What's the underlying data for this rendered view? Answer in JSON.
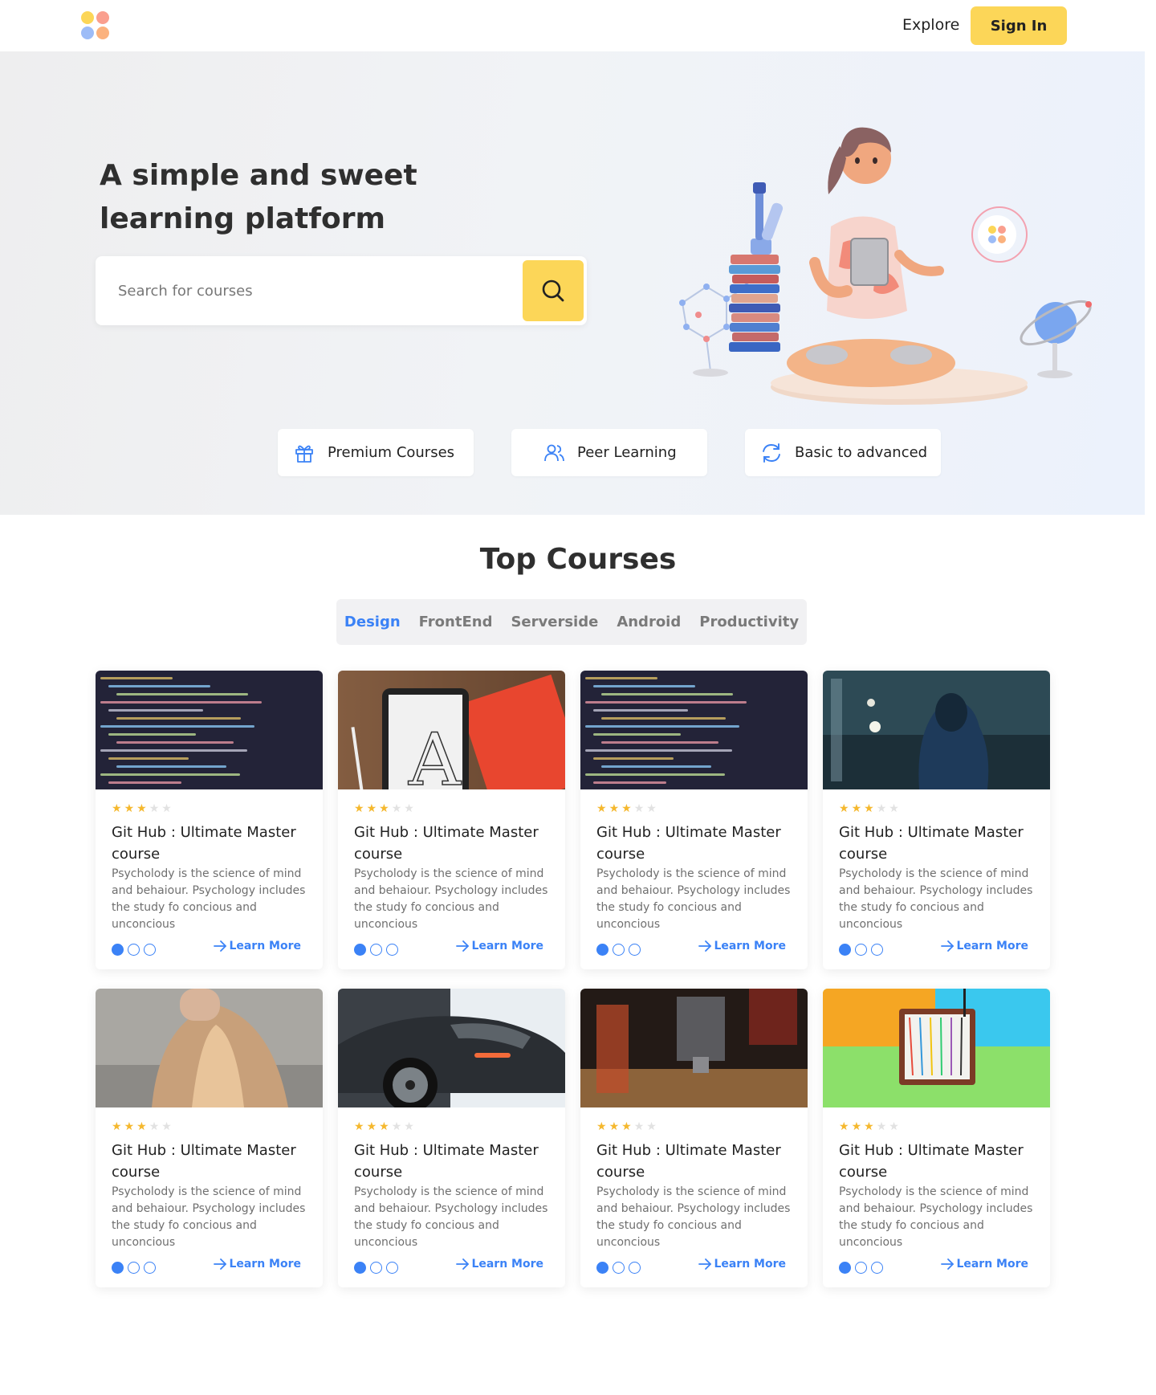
{
  "header": {
    "nav_explore": "Explore",
    "signin_label": "Sign In",
    "logo_colors": [
      "#fcd658",
      "#fa9f8e",
      "#9dbcf7",
      "#fbb27e"
    ]
  },
  "hero": {
    "title": "A simple and sweet learning platform",
    "search": {
      "placeholder": "Search for courses",
      "value": ""
    },
    "features": [
      {
        "label": "Premium Courses",
        "icon": "gift-icon"
      },
      {
        "label": "Peer Learning",
        "icon": "users-icon"
      },
      {
        "label": "Basic to advanced",
        "icon": "refresh-icon"
      }
    ]
  },
  "top_courses": {
    "title": "Top Courses",
    "tabs": [
      {
        "label": "Design",
        "active": true
      },
      {
        "label": "FrontEnd",
        "active": false
      },
      {
        "label": "Serverside",
        "active": false
      },
      {
        "label": "Android",
        "active": false
      },
      {
        "label": "Productivity",
        "active": false
      }
    ],
    "courses": [
      {
        "image": "code-screen",
        "rating": 3,
        "rating_max": 5,
        "title": "Git Hub : Ultimate Master course",
        "description": "Psycholody is the science of mind and behaiour. Psychology includes the study fo concious and unconcious",
        "cta": "Learn More",
        "dots_active": 1,
        "dots_total": 3
      },
      {
        "image": "tablet-letter",
        "rating": 3,
        "rating_max": 5,
        "title": "Git Hub : Ultimate Master course",
        "description": "Psycholody is the science of mind and behaiour. Psychology includes the study fo concious and unconcious",
        "cta": "Learn More",
        "dots_active": 1,
        "dots_total": 3
      },
      {
        "image": "code-screen",
        "rating": 3,
        "rating_max": 5,
        "title": "Git Hub : Ultimate Master course",
        "description": "Psycholody is the science of mind and behaiour. Psychology includes the study fo concious and unconcious",
        "cta": "Learn More",
        "dots_active": 1,
        "dots_total": 3
      },
      {
        "image": "hooded-person",
        "rating": 3,
        "rating_max": 5,
        "title": "Git Hub : Ultimate Master course",
        "description": "Psycholody is the science of mind and behaiour. Psychology includes the study fo concious and unconcious",
        "cta": "Learn More",
        "dots_active": 1,
        "dots_total": 3
      },
      {
        "image": "fashion-woman",
        "rating": 3,
        "rating_max": 5,
        "title": "Git Hub : Ultimate Master course",
        "description": "Psycholody is the science of mind and behaiour. Psychology includes the study fo concious and unconcious",
        "cta": "Learn More",
        "dots_active": 1,
        "dots_total": 3
      },
      {
        "image": "sports-car",
        "rating": 3,
        "rating_max": 5,
        "title": "Git Hub : Ultimate Master course",
        "description": "Psycholody is the science of mind and behaiour. Psychology includes the study fo concious and unconcious",
        "cta": "Learn More",
        "dots_active": 1,
        "dots_total": 3
      },
      {
        "image": "3d-printer",
        "rating": 3,
        "rating_max": 5,
        "title": "Git Hub : Ultimate Master course",
        "description": "Psycholody is the science of mind and behaiour. Psychology includes the study fo concious and unconcious",
        "cta": "Learn More",
        "dots_active": 1,
        "dots_total": 3
      },
      {
        "image": "breadboard",
        "rating": 3,
        "rating_max": 5,
        "title": "Git Hub : Ultimate Master course",
        "description": "Psycholody is the science of mind and behaiour. Psychology includes the study fo concious and unconcious",
        "cta": "Learn More",
        "dots_active": 1,
        "dots_total": 3
      }
    ]
  },
  "colors": {
    "accent_yellow": "#fcd658",
    "accent_blue": "#3b82f6",
    "star_filled": "#f5b82e",
    "star_empty": "#e2e2e2"
  }
}
